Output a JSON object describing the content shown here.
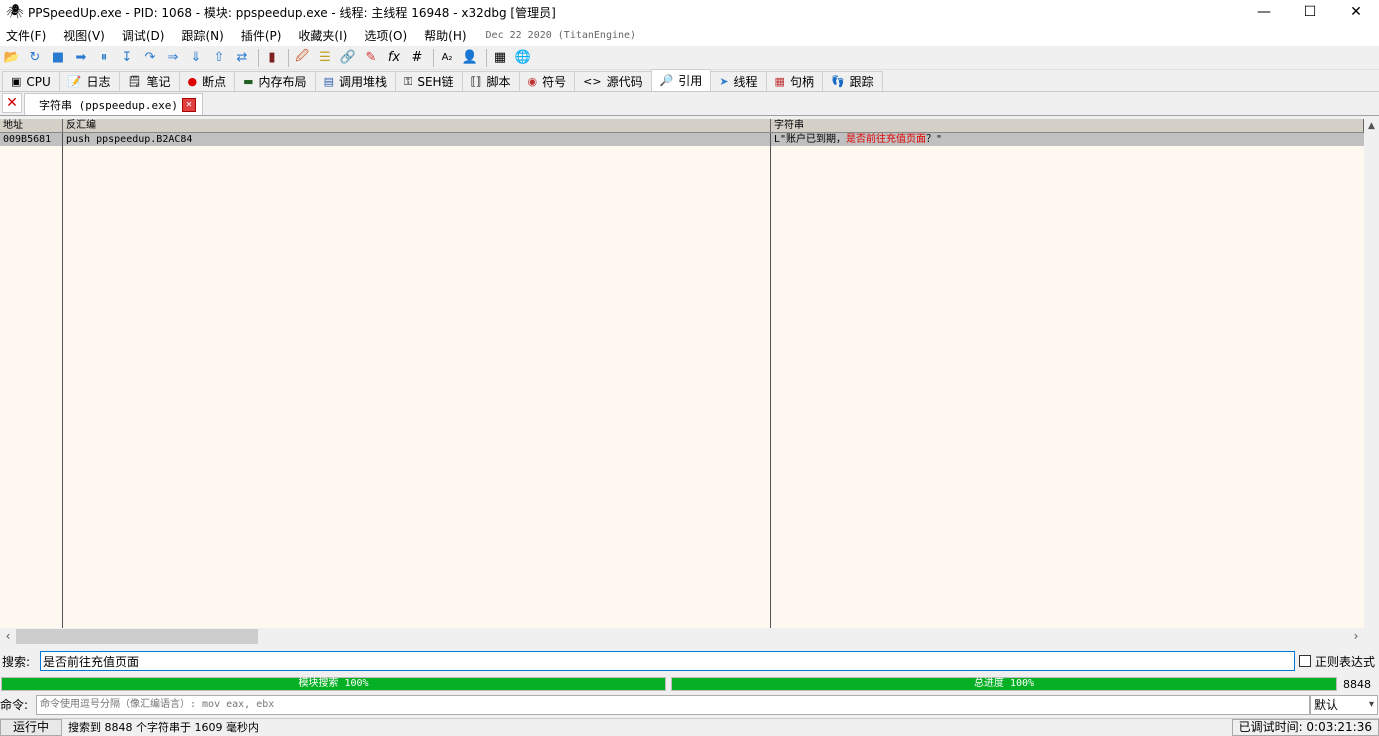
{
  "window": {
    "title": "PPSpeedUp.exe - PID: 1068 - 模块: ppspeedup.exe - 线程: 主线程 16948 - x32dbg [管理员]",
    "controls": [
      "—",
      "☐",
      "✕"
    ]
  },
  "menu": {
    "items": [
      "文件(F)",
      "视图(V)",
      "调试(D)",
      "跟踪(N)",
      "插件(P)",
      "收藏夹(I)",
      "选项(O)",
      "帮助(H)"
    ],
    "build": "Dec 22 2020 (TitanEngine)"
  },
  "toolbar": {
    "icons": [
      "📂",
      "↻",
      "■",
      "➡",
      "⏸",
      "↧",
      "↷",
      "⇒",
      "⇓",
      "⇧",
      "⇄",
      "▮",
      "🖉",
      "☰",
      "🔗",
      "✎",
      "fx",
      "#",
      "A₂",
      "👤",
      "▦",
      "🌐"
    ]
  },
  "tabs": [
    {
      "icon": "▣",
      "label": "CPU",
      "active": false
    },
    {
      "icon": "📝",
      "label": "日志",
      "active": false
    },
    {
      "icon": "🗒",
      "label": "笔记",
      "active": false
    },
    {
      "icon": "●",
      "label": "断点",
      "active": false
    },
    {
      "icon": "▬",
      "label": "内存布局",
      "active": false
    },
    {
      "icon": "▤",
      "label": "调用堆栈",
      "active": false
    },
    {
      "icon": "⚿",
      "label": "SEH链",
      "active": false
    },
    {
      "icon": "⟦⟧",
      "label": "脚本",
      "active": false
    },
    {
      "icon": "◉",
      "label": "符号",
      "active": false
    },
    {
      "icon": "<>",
      "label": "源代码",
      "active": false
    },
    {
      "icon": "🔎",
      "label": "引用",
      "active": true
    },
    {
      "icon": "➤",
      "label": "线程",
      "active": false
    },
    {
      "icon": "▦",
      "label": "句柄",
      "active": false
    },
    {
      "icon": "👣",
      "label": "跟踪",
      "active": false
    }
  ],
  "subtab": {
    "close_all": "✕",
    "label": "字符串 (ppspeedup.exe)",
    "close": "✕"
  },
  "grid": {
    "headers": [
      "地址",
      "反汇编",
      "字符串"
    ],
    "rows": [
      {
        "address": "009B5681",
        "disasm": "push ppspeedup.B2AC84",
        "str_prefix": "L\"账户已到期，",
        "str_match": "是否前往充值页面",
        "str_suffix": "？\""
      }
    ]
  },
  "search": {
    "label": "搜索:",
    "value": "是否前往充值页面",
    "regex_label": "正则表达式"
  },
  "progress": {
    "module_label": "模块搜索 100%",
    "module_value": 1.0,
    "total_label": "总进度  100%",
    "total_value": 1.0,
    "count": "8848"
  },
  "command": {
    "label": "命令:",
    "placeholder": "命令使用逗号分隔（像汇编语言）: mov eax, ebx",
    "mode": "默认"
  },
  "status": {
    "state": "运行中",
    "message": "搜索到 8848 个字符串于 1609 毫秒内",
    "time": "已调试时间:  0:03:21:36"
  }
}
